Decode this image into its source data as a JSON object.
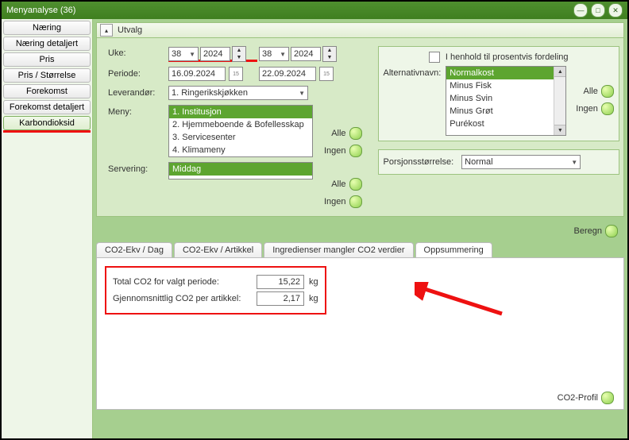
{
  "window": {
    "title": "Menyanalyse (36)"
  },
  "sidebar": {
    "items": [
      {
        "label": "Næring"
      },
      {
        "label": "Næring detaljert"
      },
      {
        "label": "Pris"
      },
      {
        "label": "Pris / Størrelse"
      },
      {
        "label": "Forekomst"
      },
      {
        "label": "Forekomst detaljert"
      },
      {
        "label": "Karbondioksid"
      }
    ]
  },
  "utvalg": {
    "title": "Utvalg",
    "labels": {
      "uke": "Uke:",
      "periode": "Periode:",
      "leverandor": "Leverandør:",
      "meny": "Meny:",
      "servering": "Servering:",
      "alternativnavn": "Alternativnavn:",
      "porsjon": "Porsjonsstørrelse:",
      "henhold": "I henhold til prosentvis fordeling",
      "alle": "Alle",
      "ingen": "Ingen",
      "beregn": "Beregn"
    },
    "week1": {
      "num": "38",
      "year": "2024"
    },
    "week2": {
      "num": "38",
      "year": "2024"
    },
    "date_from": "16.09.2024",
    "date_to": "22.09.2024",
    "leverandor_selected": "1. Ringerikskjøkken",
    "meny_items": [
      {
        "label": "1. Institusjon",
        "selected": true
      },
      {
        "label": "2. Hjemmeboende & Bofellesskap"
      },
      {
        "label": "3. Servicesenter"
      },
      {
        "label": "4. Klimameny"
      }
    ],
    "servering_items": [
      {
        "label": "Middag",
        "selected": true
      }
    ],
    "alt_items": [
      {
        "label": "Normalkost",
        "selected": true
      },
      {
        "label": "Minus Fisk"
      },
      {
        "label": "Minus Svin"
      },
      {
        "label": "Minus Grøt"
      },
      {
        "label": "Purékost"
      }
    ],
    "porsjon_selected": "Normal"
  },
  "tabs": {
    "items": [
      {
        "label": "CO2-Ekv / Dag"
      },
      {
        "label": "CO2-Ekv / Artikkel"
      },
      {
        "label": "Ingredienser mangler CO2 verdier"
      },
      {
        "label": "Oppsummering"
      }
    ],
    "summary": {
      "row1_label": "Total CO2 for valgt periode:",
      "row1_value": "15,22",
      "row2_label": "Gjennomsnittlig CO2 per artikkel:",
      "row2_value": "2,17",
      "unit": "kg"
    },
    "co2profil": "CO2-Profil"
  }
}
